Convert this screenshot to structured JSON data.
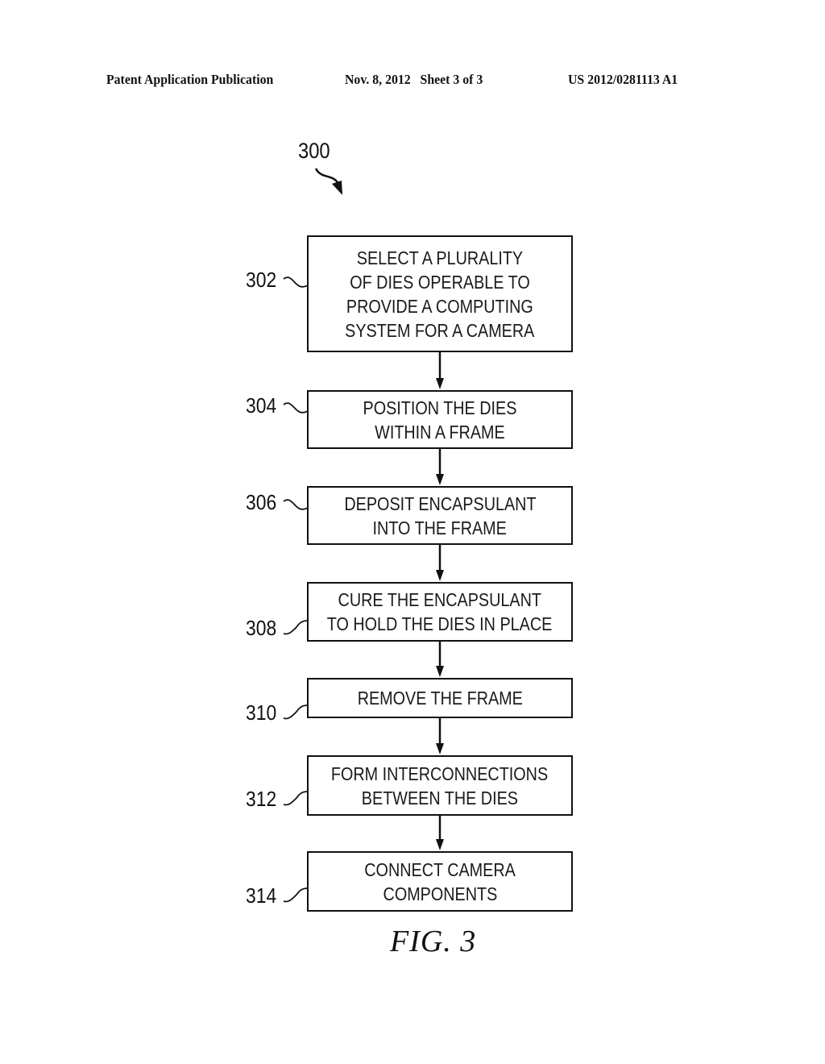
{
  "header": {
    "publication_type": "Patent Application Publication",
    "date_sheet": "Nov. 8, 2012   Sheet 3 of 3",
    "publication_number": "US 2012/0281113 A1"
  },
  "figure": {
    "reference_number": "300",
    "caption": "FIG. 3",
    "steps": [
      {
        "ref": "302",
        "lines": [
          "SELECT A PLURALITY",
          "OF DIES OPERABLE TO",
          "PROVIDE A COMPUTING",
          "SYSTEM FOR A CAMERA"
        ]
      },
      {
        "ref": "304",
        "lines": [
          "POSITION THE DIES",
          "WITHIN A FRAME"
        ]
      },
      {
        "ref": "306",
        "lines": [
          "DEPOSIT ENCAPSULANT",
          "INTO THE FRAME"
        ]
      },
      {
        "ref": "308",
        "lines": [
          "CURE THE ENCAPSULANT",
          "TO HOLD THE DIES IN PLACE"
        ]
      },
      {
        "ref": "310",
        "lines": [
          "REMOVE THE FRAME"
        ]
      },
      {
        "ref": "312",
        "lines": [
          "FORM INTERCONNECTIONS",
          "BETWEEN THE DIES"
        ]
      },
      {
        "ref": "314",
        "lines": [
          "CONNECT CAMERA",
          "COMPONENTS"
        ]
      }
    ]
  }
}
